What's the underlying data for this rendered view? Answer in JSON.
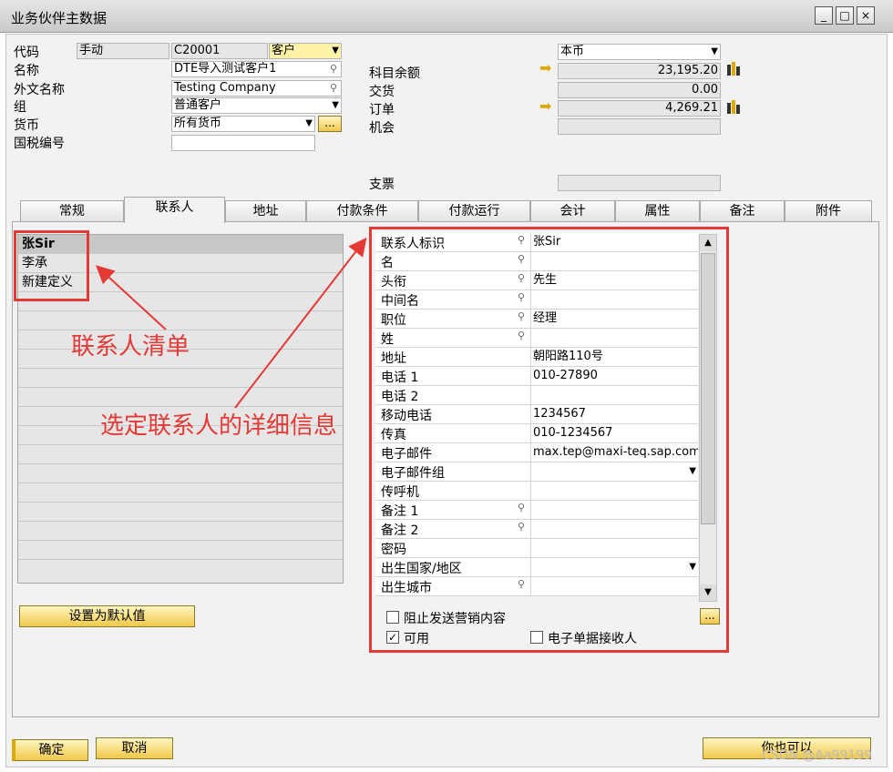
{
  "window": {
    "title": "业务伙伴主数据",
    "min": "_",
    "max": "□",
    "close": "×"
  },
  "header": {
    "code_label": "代码",
    "code_mode": "手动",
    "code_value": "C20001",
    "code_type": "客户",
    "name_label": "名称",
    "name_value": "DTE导入测试客户1",
    "foreign_label": "外文名称",
    "foreign_value": "Testing Company",
    "group_label": "组",
    "group_value": "普通客户",
    "currency_label": "货币",
    "currency_value": "所有货币",
    "currency_btn": "...",
    "tax_label": "国税编号",
    "tax_value": "",
    "curtype_value": "本币",
    "balance_label": "科目余额",
    "balance_value": "23,195.20",
    "delivery_label": "交货",
    "delivery_value": "0.00",
    "order_label": "订单",
    "order_value": "4,269.21",
    "opportunity_label": "机会",
    "opportunity_value": "",
    "check_label": "支票",
    "check_value": ""
  },
  "tabs": [
    "常规",
    "联系人",
    "地址",
    "付款条件",
    "付款运行",
    "会计",
    "属性",
    "备注",
    "附件"
  ],
  "contacts": [
    "张Sir",
    "李承",
    "新建定义"
  ],
  "default_btn": "设置为默认值",
  "detail": [
    {
      "label": "联系人标识",
      "pin": true,
      "value": "张Sir"
    },
    {
      "label": "名",
      "pin": true,
      "value": ""
    },
    {
      "label": "头衔",
      "pin": true,
      "value": "先生"
    },
    {
      "label": "中间名",
      "pin": true,
      "value": ""
    },
    {
      "label": "职位",
      "pin": true,
      "value": "经理"
    },
    {
      "label": "姓",
      "pin": true,
      "value": ""
    },
    {
      "label": "地址",
      "pin": false,
      "value": "朝阳路110号"
    },
    {
      "label": "电话 1",
      "pin": false,
      "value": "010-27890"
    },
    {
      "label": "电话 2",
      "pin": false,
      "value": ""
    },
    {
      "label": "移动电话",
      "pin": false,
      "value": "1234567"
    },
    {
      "label": "传真",
      "pin": false,
      "value": "010-1234567"
    },
    {
      "label": "电子邮件",
      "pin": false,
      "value": "max.tep@maxi-teq.sap.com"
    },
    {
      "label": "电子邮件组",
      "pin": false,
      "value": "",
      "dropdown": true
    },
    {
      "label": "传呼机",
      "pin": false,
      "value": ""
    },
    {
      "label": "备注 1",
      "pin": true,
      "value": ""
    },
    {
      "label": "备注 2",
      "pin": true,
      "value": ""
    },
    {
      "label": "密码",
      "pin": false,
      "value": ""
    },
    {
      "label": "出生国家/地区",
      "pin": false,
      "value": "",
      "dropdown": true
    },
    {
      "label": "出生城市",
      "pin": true,
      "value": ""
    }
  ],
  "checkboxes": {
    "block_marketing": "阻止发送营销内容",
    "active": "可用",
    "e_receiver": "电子单据接收人"
  },
  "more_btn": "...",
  "annotations": {
    "list": "联系人清单",
    "detail": "选定联系人的详细信息"
  },
  "footer": {
    "ok": "确定",
    "cancel": "取消",
    "also": "你也可以"
  },
  "watermark": "CSDN @Aa99199",
  "colors": {
    "annotation": "#e53935",
    "button": "#f0c84a",
    "link_arrow": "#e0a800"
  }
}
